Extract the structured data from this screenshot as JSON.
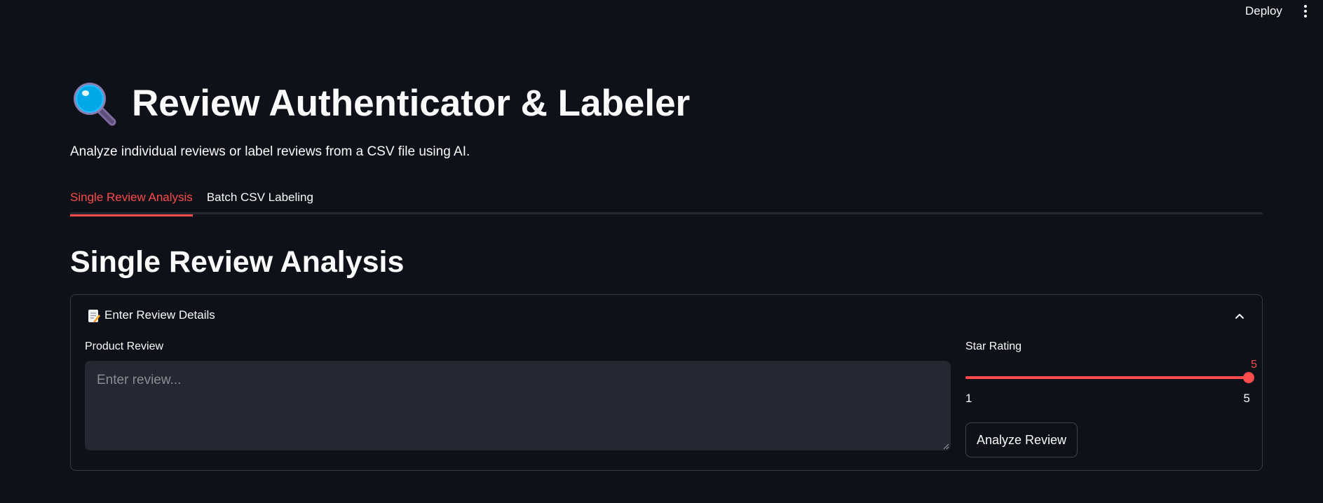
{
  "header": {
    "deploy_label": "Deploy",
    "menu_icon": "vertical-dots-icon"
  },
  "app": {
    "title_icon": "magnifying-glass-icon",
    "title": "Review Authenticator & Labeler",
    "subtitle": "Analyze individual reviews or label reviews from a CSV file using AI."
  },
  "tabs": [
    {
      "label": "Single Review Analysis",
      "active": true
    },
    {
      "label": "Batch CSV Labeling",
      "active": false
    }
  ],
  "main": {
    "section_heading": "Single Review Analysis",
    "expander": {
      "icon": "memo-icon",
      "label": "Enter Review Details",
      "expanded": true,
      "review": {
        "label": "Product Review",
        "placeholder": "Enter review...",
        "value": ""
      },
      "rating": {
        "label": "Star Rating",
        "min": 1,
        "max": 5,
        "value": 5,
        "value_text": "5",
        "min_text": "1",
        "max_text": "5"
      },
      "analyze_label": "Analyze Review"
    }
  },
  "colors": {
    "background": "#0e1117",
    "accent": "#ff4b4b",
    "input_bg": "#262730",
    "text": "#fafafa"
  }
}
